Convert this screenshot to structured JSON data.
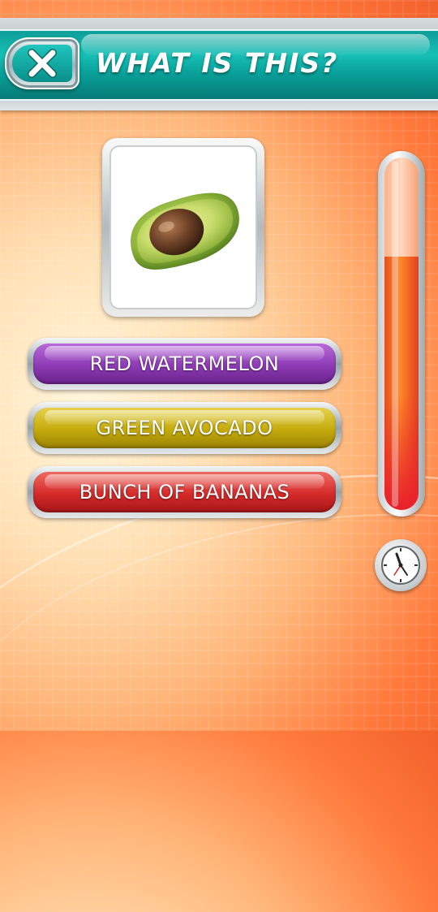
{
  "header": {
    "title": "WHAT IS THIS?",
    "close_icon": "close-x-icon"
  },
  "question": {
    "image_icon": "avocado-half-icon"
  },
  "answers": [
    {
      "label": "RED WATERMELON",
      "color": "#8d3bb5"
    },
    {
      "label": "GREEN AVOCADO",
      "color": "#c4aa0c"
    },
    {
      "label": "BUNCH OF BANANAS",
      "color": "#d42a2a"
    }
  ],
  "timer": {
    "remaining_fraction": 0.72,
    "icon": "clock-icon"
  },
  "colors": {
    "header_teal": "#0fa8a0",
    "background_orange": "#ff7a3c"
  }
}
